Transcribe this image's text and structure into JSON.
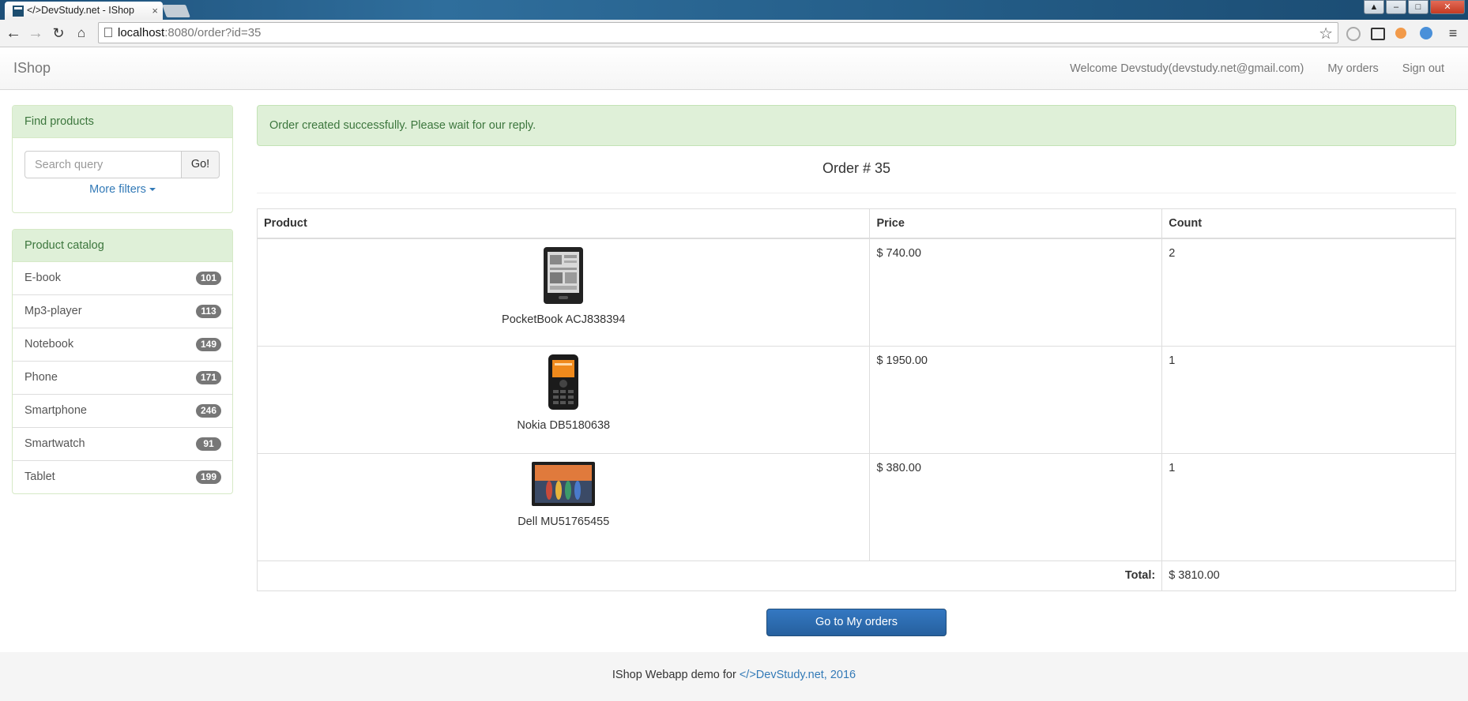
{
  "browser": {
    "tab_title": "</>DevStudy.net - IShop",
    "url_host": "localhost",
    "url_rest": ":8080/order?id=35"
  },
  "navbar": {
    "brand": "IShop",
    "welcome": "Welcome Devstudy(devstudy.net@gmail.com)",
    "my_orders": "My orders",
    "sign_out": "Sign out"
  },
  "sidebar": {
    "find_title": "Find products",
    "search_placeholder": "Search query",
    "go_label": "Go!",
    "more_filters": "More filters",
    "catalog_title": "Product catalog",
    "categories": [
      {
        "name": "E-book",
        "count": "101"
      },
      {
        "name": "Mp3-player",
        "count": "113"
      },
      {
        "name": "Notebook",
        "count": "149"
      },
      {
        "name": "Phone",
        "count": "171"
      },
      {
        "name": "Smartphone",
        "count": "246"
      },
      {
        "name": "Smartwatch",
        "count": "91"
      },
      {
        "name": "Tablet",
        "count": "199"
      }
    ]
  },
  "main": {
    "alert": "Order created successfully. Please wait for our reply.",
    "order_title": "Order # 35",
    "columns": {
      "product": "Product",
      "price": "Price",
      "count": "Count"
    },
    "items": [
      {
        "name": "PocketBook ACJ838394",
        "price": "$ 740.00",
        "count": "2",
        "image": "ebook-image"
      },
      {
        "name": "Nokia DB5180638",
        "price": "$ 1950.00",
        "count": "1",
        "image": "phone-image"
      },
      {
        "name": "Dell MU51765455",
        "price": "$ 380.00",
        "count": "1",
        "image": "tablet-image"
      }
    ],
    "total_label": "Total:",
    "total_value": "$ 3810.00",
    "goto_button": "Go to My orders"
  },
  "footer": {
    "text": "IShop Webapp demo for ",
    "link": "</>DevStudy.net, 2016"
  }
}
